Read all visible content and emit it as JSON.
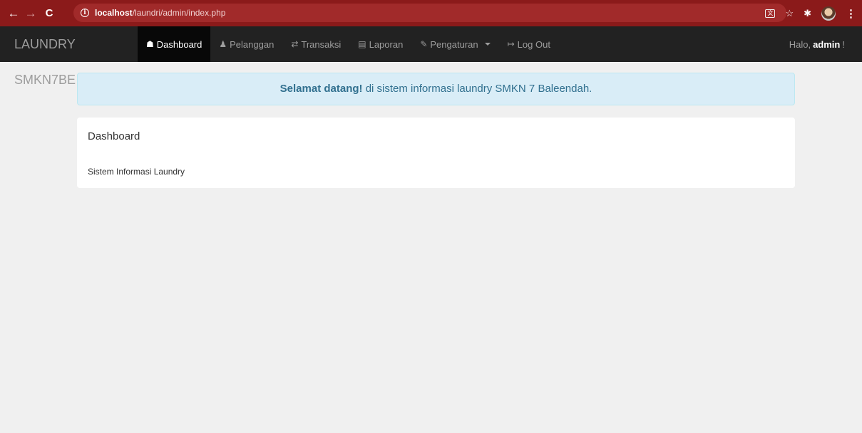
{
  "browser": {
    "url_host": "localhost",
    "url_path": "/laundri/admin/index.php"
  },
  "navbar": {
    "brand": "LAUNDRY SMKN7BE",
    "items": [
      {
        "label": "Dashboard",
        "icon": "home-icon",
        "active": true
      },
      {
        "label": "Pelanggan",
        "icon": "user-icon"
      },
      {
        "label": "Transaksi",
        "icon": "shuffle-icon"
      },
      {
        "label": "Laporan",
        "icon": "list-icon"
      },
      {
        "label": "Pengaturan",
        "icon": "wrench-icon",
        "dropdown": true
      },
      {
        "label": "Log Out",
        "icon": "logout-icon"
      }
    ],
    "greeting_prefix": "Halo,",
    "username": "admin",
    "greeting_suffix": "!"
  },
  "alert": {
    "strong": "Selamat datang!",
    "text": " di sistem informasi laundry SMKN 7 Baleendah."
  },
  "panel": {
    "title": "Dashboard",
    "body": "Sistem Informasi Laundry"
  },
  "colors": {
    "chrome": "#8b1a1a",
    "navbar": "#222222",
    "alert_bg": "#d9edf7",
    "alert_text": "#31708f"
  }
}
